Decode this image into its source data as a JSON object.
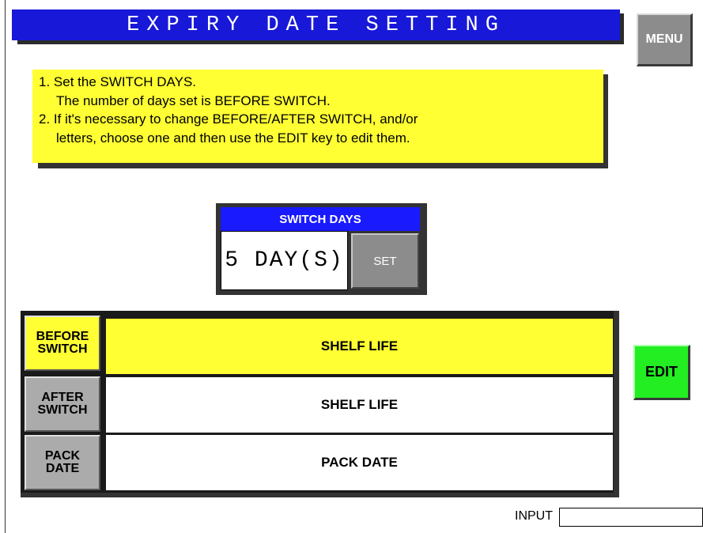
{
  "title": "EXPIRY DATE SETTING",
  "menu_button": "MENU",
  "instructions": {
    "line1": "1. Set the SWITCH DAYS.",
    "line2": "The number of days set is BEFORE SWITCH.",
    "line3": "2. If it's necessary to change BEFORE/AFTER SWITCH, and/or",
    "line4": "letters, choose one and then use the EDIT key to edit them."
  },
  "switch_days": {
    "header": "SWITCH DAYS",
    "value": "5 DAY(S)",
    "set_button": "SET"
  },
  "rows": [
    {
      "label_line1": "BEFORE",
      "label_line2": "SWITCH",
      "value": "SHELF LIFE",
      "selected": true
    },
    {
      "label_line1": "AFTER",
      "label_line2": "SWITCH",
      "value": "SHELF LIFE",
      "selected": false
    },
    {
      "label_line1": "PACK",
      "label_line2": "DATE",
      "value": "PACK DATE",
      "selected": false
    }
  ],
  "edit_button": "EDIT",
  "input": {
    "label": "INPUT",
    "value": ""
  },
  "colors": {
    "title_bar": "#1818d8",
    "highlight": "#ffff33",
    "edit_button": "#22ee22",
    "button_gray": "#8c8c8c",
    "switch_header": "#1a1aff"
  }
}
